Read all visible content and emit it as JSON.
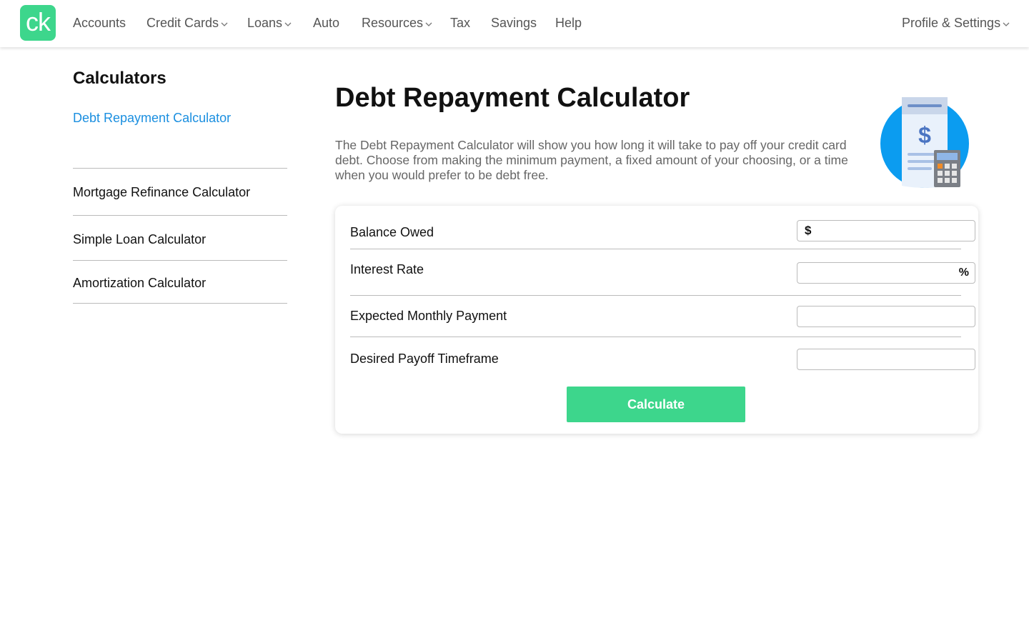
{
  "brand": {
    "logo_text": "ck",
    "color": "#3dd68c"
  },
  "nav": {
    "items": [
      {
        "label": "Accounts",
        "has_dropdown": false
      },
      {
        "label": "Credit Cards",
        "has_dropdown": true
      },
      {
        "label": "Loans",
        "has_dropdown": true
      },
      {
        "label": "Auto",
        "has_dropdown": false
      },
      {
        "label": "Resources",
        "has_dropdown": true
      },
      {
        "label": "Tax",
        "has_dropdown": false
      },
      {
        "label": "Savings",
        "has_dropdown": false
      },
      {
        "label": "Help",
        "has_dropdown": false
      }
    ],
    "profile": {
      "label": "Profile & Settings",
      "has_dropdown": true
    }
  },
  "sidebar": {
    "title": "Calculators",
    "items": [
      {
        "label": "Debt Repayment Calculator",
        "active": true
      },
      {
        "label": "Mortgage Refinance Calculator",
        "active": false
      },
      {
        "label": "Simple Loan Calculator",
        "active": false
      },
      {
        "label": "Amortization Calculator",
        "active": false
      }
    ]
  },
  "main": {
    "title": "Debt Repayment Calculator",
    "description": "The Debt Repayment Calculator will show you how long it will take to pay off your credit card debt. Choose from making the minimum payment, a fixed amount of your choosing, or a time when you would prefer to be debt free.",
    "illustration_icon": "receipt-calculator-icon",
    "form": {
      "fields": [
        {
          "label": "Balance Owed",
          "value": "",
          "prefix": "$",
          "suffix": ""
        },
        {
          "label": "Interest Rate",
          "value": "",
          "prefix": "",
          "suffix": "%"
        },
        {
          "label": "Expected Monthly Payment",
          "value": "",
          "prefix": "",
          "suffix": ""
        },
        {
          "label": "Desired Payoff Timeframe",
          "value": "",
          "prefix": "",
          "suffix": ""
        }
      ],
      "submit_label": "Calculate"
    }
  },
  "colors": {
    "accent_green": "#3dd68c",
    "active_link_blue": "#1b8fe0",
    "illustration_blue": "#0b9cf0"
  }
}
